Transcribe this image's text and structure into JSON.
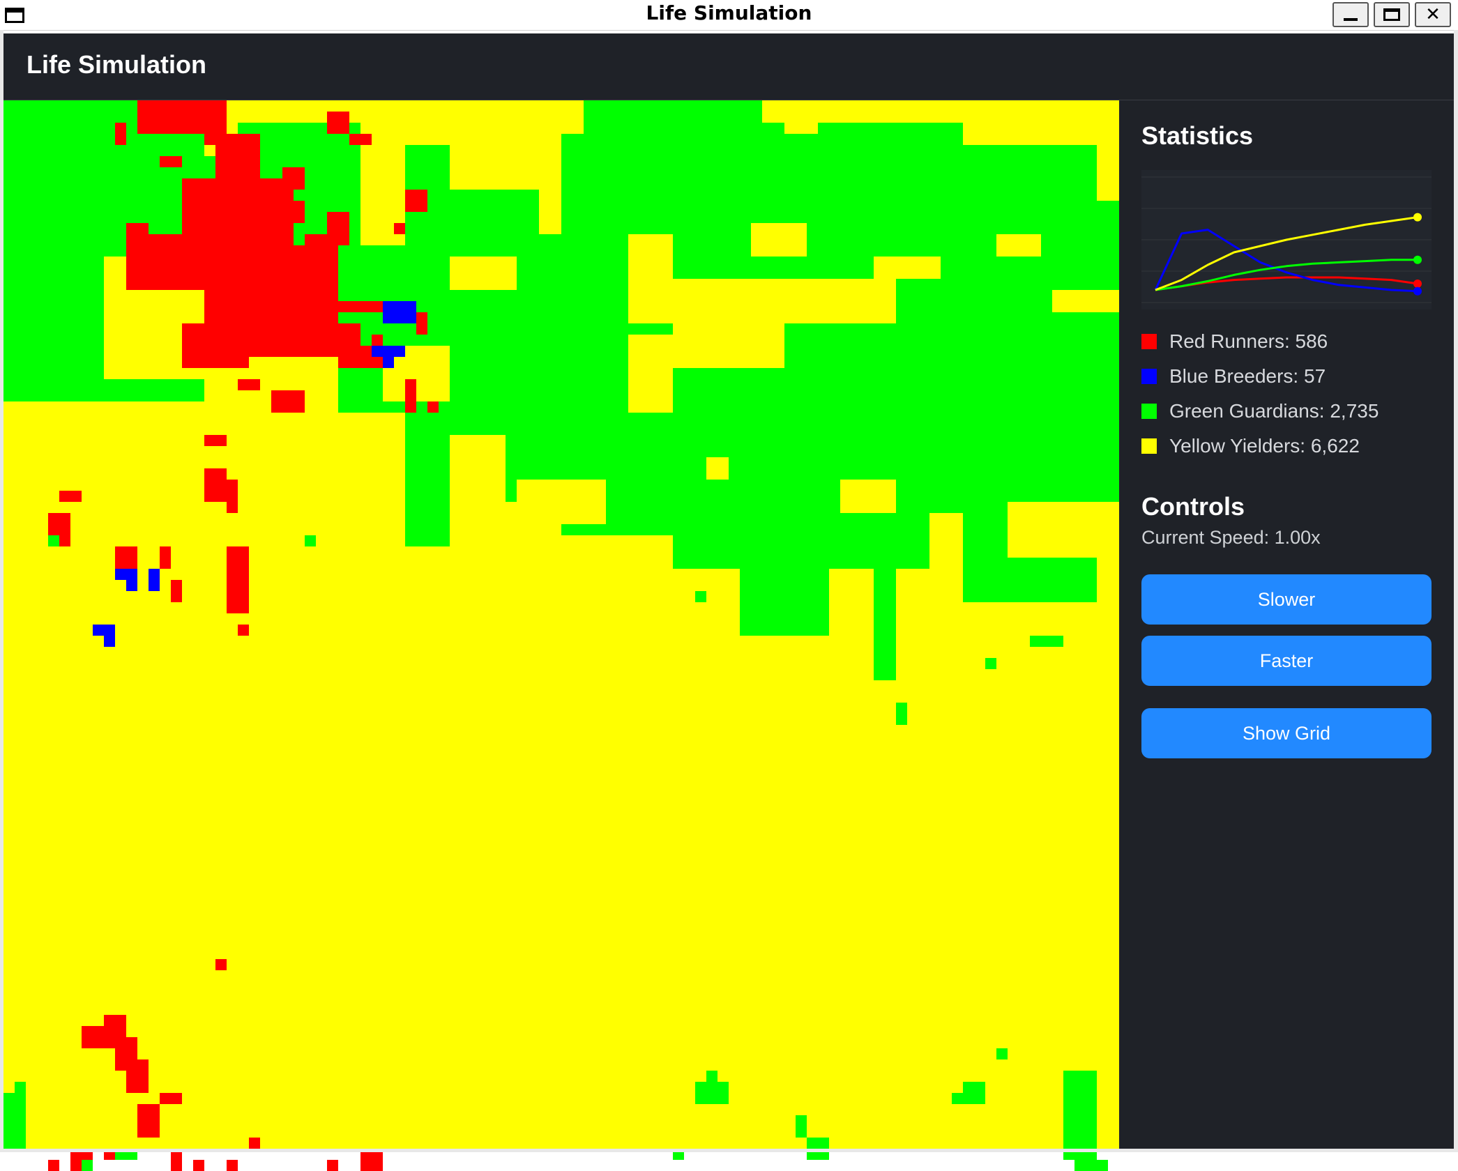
{
  "window": {
    "title": "Life Simulation"
  },
  "header": {
    "title": "Life Simulation"
  },
  "colors": {
    "red": "#ff0000",
    "blue": "#0000ff",
    "green": "#00ff00",
    "yellow": "#ffff00",
    "panel": "#1f2228",
    "button": "#2289ff"
  },
  "stats": {
    "title": "Statistics",
    "items": [
      {
        "label": "Red Runners: 586",
        "color": "#ff0000"
      },
      {
        "label": "Blue Breeders: 57",
        "color": "#0000ff"
      },
      {
        "label": "Green Guardians: 2,735",
        "color": "#00ff00"
      },
      {
        "label": "Yellow Yielders: 6,622",
        "color": "#ffff00"
      }
    ]
  },
  "chart_data": {
    "type": "line",
    "title": "",
    "x": [
      0,
      1,
      2,
      3,
      4,
      5,
      6,
      7,
      8,
      9,
      10
    ],
    "series": [
      {
        "name": "Red Runners",
        "color": "#ff0000",
        "values": [
          0.1,
          0.13,
          0.16,
          0.18,
          0.19,
          0.2,
          0.2,
          0.2,
          0.19,
          0.18,
          0.15
        ]
      },
      {
        "name": "Blue Breeders",
        "color": "#0000ff",
        "values": [
          0.1,
          0.55,
          0.58,
          0.45,
          0.32,
          0.24,
          0.18,
          0.14,
          0.12,
          0.1,
          0.09
        ]
      },
      {
        "name": "Green Guardians",
        "color": "#00ff00",
        "values": [
          0.1,
          0.13,
          0.17,
          0.22,
          0.26,
          0.29,
          0.31,
          0.32,
          0.33,
          0.34,
          0.34
        ]
      },
      {
        "name": "Yellow Yielders",
        "color": "#ffff00",
        "values": [
          0.1,
          0.18,
          0.3,
          0.4,
          0.45,
          0.5,
          0.54,
          0.58,
          0.62,
          0.65,
          0.68
        ]
      }
    ],
    "ylim": [
      0,
      1
    ],
    "grid": true
  },
  "controls": {
    "title": "Controls",
    "speed": "Current Speed: 1.00x",
    "slower": "Slower",
    "faster": "Faster",
    "grid_toggle": "Show Grid"
  },
  "simulation_grid": {
    "cols": 100,
    "rows": 94,
    "background": "#ffff00",
    "green_spans": [
      [
        0,
        0,
        18,
        27
      ],
      [
        18,
        9,
        32,
        5
      ],
      [
        22,
        14,
        30,
        4
      ],
      [
        21,
        18,
        32,
        2
      ],
      [
        24,
        20,
        60,
        20
      ],
      [
        30,
        28,
        38,
        13
      ],
      [
        36,
        30,
        48,
        8
      ],
      [
        45,
        36,
        56,
        12
      ],
      [
        40,
        40,
        36,
        4
      ],
      [
        50,
        0,
        68,
        12
      ],
      [
        56,
        8,
        78,
        4
      ],
      [
        60,
        2,
        86,
        16
      ],
      [
        68,
        4,
        98,
        9
      ],
      [
        80,
        9,
        100,
        25
      ],
      [
        70,
        20,
        100,
        36
      ],
      [
        60,
        24,
        90,
        42
      ],
      [
        50,
        28,
        86,
        39
      ],
      [
        64,
        35,
        70,
        41
      ],
      [
        66,
        42,
        74,
        48
      ],
      [
        78,
        40,
        80,
        52
      ],
      [
        86,
        41,
        98,
        45
      ],
      [
        92,
        48,
        95,
        49
      ],
      [
        101,
        34,
        100,
        40
      ],
      [
        61,
        9,
        56,
        14
      ],
      [
        86,
        12,
        100,
        27
      ]
    ],
    "yellow_spans": [
      [
        9,
        14,
        20,
        25
      ],
      [
        14,
        13,
        17,
        15
      ],
      [
        20,
        39,
        26,
        44
      ],
      [
        26,
        40,
        33,
        43
      ],
      [
        46,
        34,
        54,
        38
      ],
      [
        63,
        32,
        65,
        34
      ],
      [
        56,
        12,
        60,
        18
      ],
      [
        67,
        11,
        72,
        14
      ],
      [
        78,
        14,
        84,
        16
      ],
      [
        89,
        12,
        93,
        14
      ],
      [
        94,
        17,
        100,
        19
      ],
      [
        75,
        34,
        80,
        37
      ],
      [
        83,
        37,
        86,
        42
      ],
      [
        40,
        14,
        46,
        17
      ],
      [
        34,
        22,
        40,
        27
      ],
      [
        42,
        0,
        44,
        2
      ],
      [
        49,
        0,
        52,
        3
      ],
      [
        70,
        0,
        73,
        3
      ],
      [
        88,
        1,
        92,
        3
      ]
    ],
    "red_blocks": [
      [
        12,
        0,
        20,
        3
      ],
      [
        18,
        3,
        23,
        4
      ],
      [
        19,
        4,
        23,
        7
      ],
      [
        16,
        7,
        26,
        15
      ],
      [
        11,
        12,
        18,
        17
      ],
      [
        18,
        15,
        30,
        23
      ],
      [
        16,
        20,
        22,
        24
      ],
      [
        24,
        13,
        28,
        15
      ],
      [
        28,
        13,
        30,
        14
      ],
      [
        11,
        11,
        13,
        13
      ],
      [
        10,
        2,
        11,
        4
      ],
      [
        14,
        5,
        16,
        6
      ],
      [
        29,
        1,
        31,
        3
      ],
      [
        31,
        3,
        33,
        4
      ],
      [
        25,
        6,
        27,
        8
      ],
      [
        24,
        9,
        27,
        11
      ],
      [
        29,
        10,
        31,
        13
      ],
      [
        27,
        12,
        30,
        19
      ],
      [
        29,
        18,
        34,
        19
      ],
      [
        26,
        20,
        32,
        22
      ],
      [
        30,
        22,
        33,
        24
      ],
      [
        33,
        21,
        34,
        24
      ],
      [
        36,
        8,
        38,
        10
      ],
      [
        35,
        11,
        36,
        12
      ],
      [
        37,
        19,
        38,
        21
      ],
      [
        36,
        25,
        37,
        28
      ],
      [
        38,
        27,
        39,
        28
      ],
      [
        21,
        25,
        23,
        26
      ],
      [
        24,
        26,
        27,
        28
      ],
      [
        18,
        30,
        20,
        31
      ],
      [
        18,
        33,
        20,
        36
      ],
      [
        20,
        34,
        21,
        37
      ],
      [
        5,
        35,
        7,
        36
      ],
      [
        4,
        37,
        6,
        40
      ],
      [
        10,
        40,
        12,
        42
      ],
      [
        14,
        40,
        15,
        42
      ],
      [
        20,
        40,
        22,
        46
      ],
      [
        15,
        43,
        16,
        45
      ],
      [
        21,
        47,
        22,
        48
      ],
      [
        9,
        82,
        11,
        84
      ],
      [
        7,
        83,
        10,
        85
      ],
      [
        10,
        84,
        12,
        87
      ],
      [
        11,
        86,
        13,
        89
      ],
      [
        14,
        89,
        16,
        90
      ],
      [
        12,
        90,
        14,
        93
      ],
      [
        9,
        94,
        11,
        95
      ],
      [
        6,
        94,
        8,
        96
      ],
      [
        15,
        94,
        16,
        96
      ],
      [
        17,
        95,
        18,
        96
      ],
      [
        19,
        77,
        20,
        78
      ],
      [
        22,
        93,
        23,
        94
      ],
      [
        20,
        95,
        21,
        96
      ],
      [
        4,
        95,
        5,
        96
      ],
      [
        29,
        95,
        30,
        96
      ],
      [
        32,
        94,
        34,
        96
      ]
    ],
    "green_patches_bottom": [
      [
        0,
        89,
        2,
        94
      ],
      [
        1,
        88,
        2,
        89
      ],
      [
        10,
        94,
        12,
        95
      ],
      [
        7,
        95,
        8,
        96
      ],
      [
        62,
        88,
        65,
        90
      ],
      [
        63,
        87,
        64,
        88
      ],
      [
        60,
        94,
        61,
        95
      ],
      [
        71,
        91,
        72,
        93
      ],
      [
        72,
        93,
        74,
        95
      ],
      [
        86,
        88,
        88,
        90
      ],
      [
        89,
        85,
        90,
        86
      ],
      [
        95,
        87,
        98,
        95
      ],
      [
        96,
        95,
        99,
        96
      ],
      [
        85,
        89,
        86,
        90
      ],
      [
        27,
        39,
        28,
        40
      ],
      [
        4,
        39,
        5,
        40
      ],
      [
        80,
        54,
        81,
        56
      ],
      [
        62,
        44,
        63,
        45
      ],
      [
        88,
        50,
        89,
        51
      ],
      [
        78,
        46,
        80,
        48
      ]
    ],
    "blue_blocks": [
      [
        34,
        18,
        37,
        20
      ],
      [
        33,
        22,
        36,
        23
      ],
      [
        34,
        23,
        35,
        24
      ],
      [
        10,
        42,
        12,
        43
      ],
      [
        11,
        43,
        12,
        44
      ],
      [
        13,
        42,
        14,
        44
      ],
      [
        8,
        47,
        10,
        48
      ],
      [
        9,
        48,
        10,
        49
      ]
    ]
  }
}
